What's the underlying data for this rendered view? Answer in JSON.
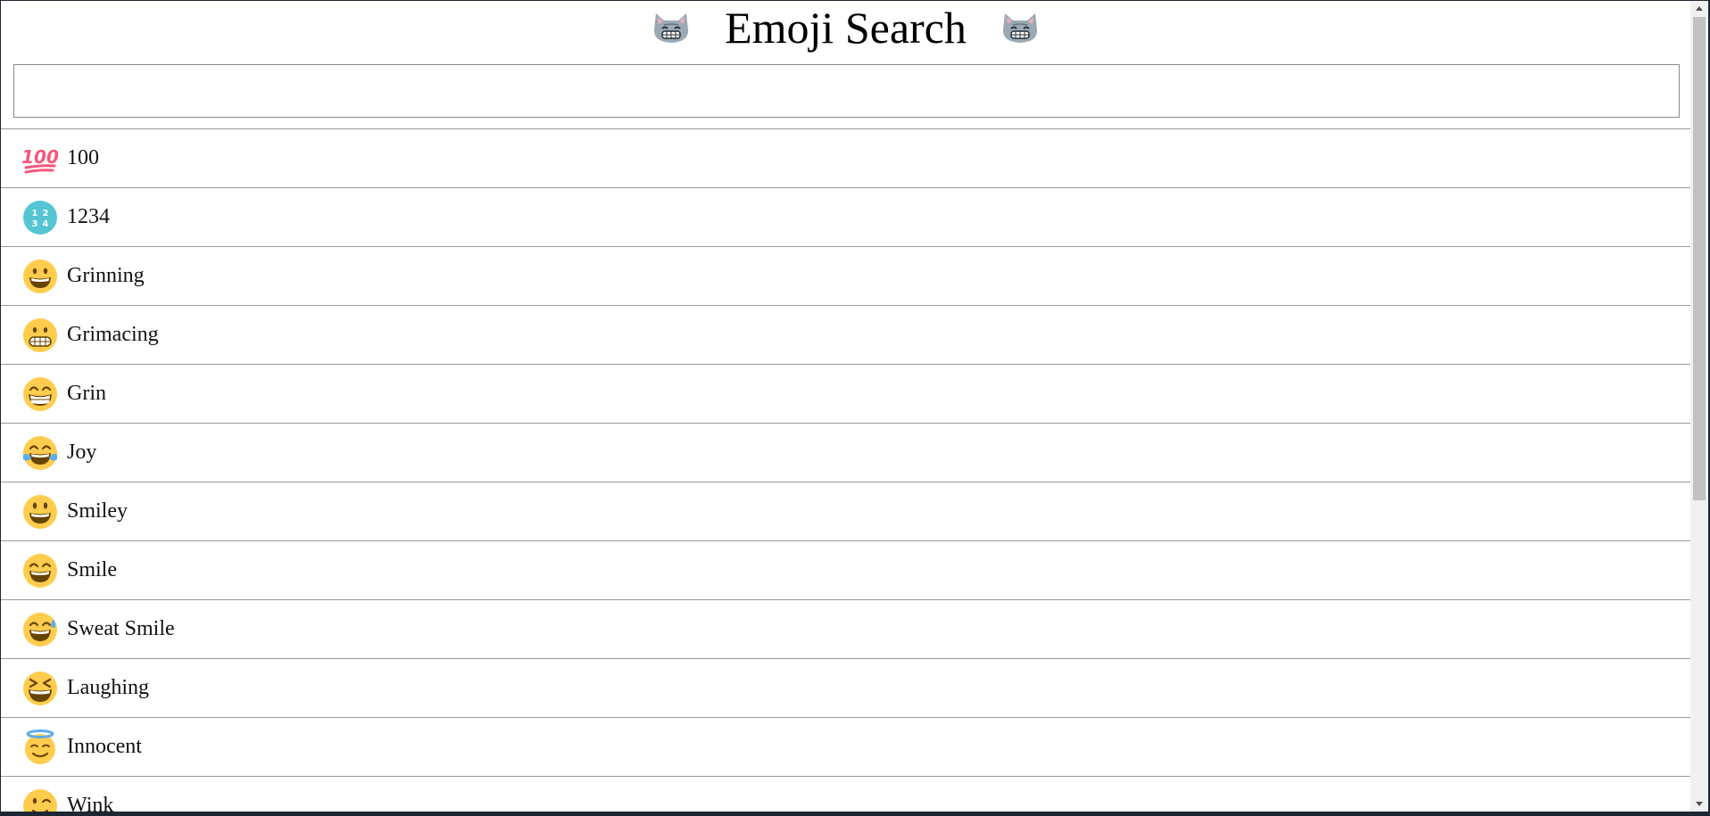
{
  "header": {
    "title": "Emoji Search",
    "left_icon": "grinning-cat-icon",
    "right_icon": "grinning-cat-icon"
  },
  "search": {
    "value": "",
    "placeholder": ""
  },
  "emojis": [
    {
      "label": "100",
      "icon": "hundred-points-icon"
    },
    {
      "label": "1234",
      "icon": "input-numbers-icon"
    },
    {
      "label": "Grinning",
      "icon": "grinning-face-icon"
    },
    {
      "label": "Grimacing",
      "icon": "grimacing-face-icon"
    },
    {
      "label": "Grin",
      "icon": "grin-face-icon"
    },
    {
      "label": "Joy",
      "icon": "joy-face-icon"
    },
    {
      "label": "Smiley",
      "icon": "smiley-face-icon"
    },
    {
      "label": "Smile",
      "icon": "smile-face-icon"
    },
    {
      "label": "Sweat Smile",
      "icon": "sweat-smile-face-icon"
    },
    {
      "label": "Laughing",
      "icon": "laughing-face-icon"
    },
    {
      "label": "Innocent",
      "icon": "innocent-face-icon"
    },
    {
      "label": "Wink",
      "icon": "wink-face-icon"
    }
  ],
  "colors": {
    "face": "#ffcc4d",
    "hundred": "#f4587a",
    "numbers": "#55c5d3",
    "halo": "#5dadec",
    "tears": "#5dadec"
  }
}
